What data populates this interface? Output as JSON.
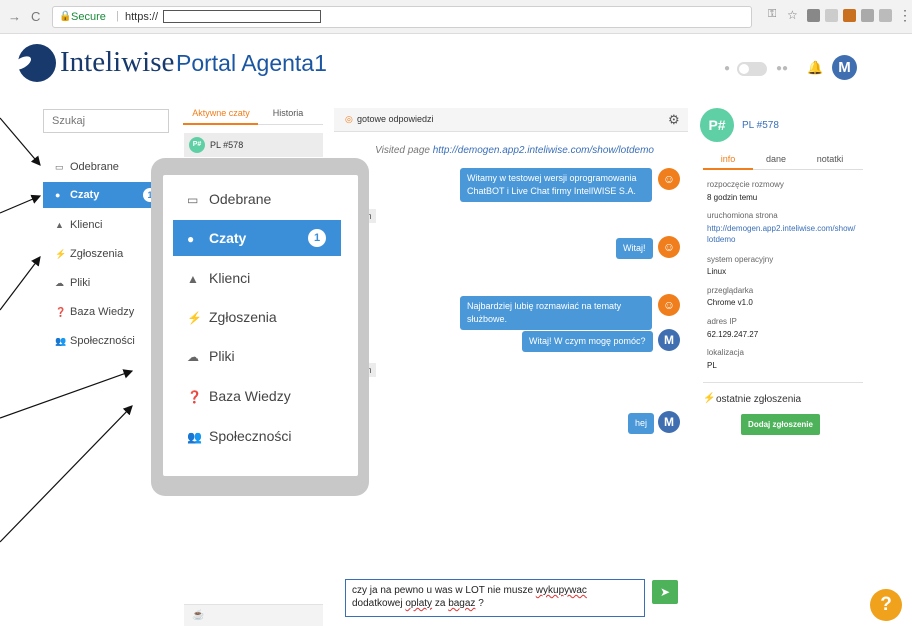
{
  "browser": {
    "back_icon": "arrow-left-icon",
    "reload_glyph": "C",
    "secure_label": "Secure",
    "url_prefix": "https://",
    "menu_glyph": "⋮"
  },
  "header": {
    "brand": "Inteliwise",
    "portal_title": "Portal Agenta1",
    "avatar_letter": "M"
  },
  "sidebar": {
    "search_placeholder": "Szukaj",
    "items": [
      {
        "label": "Odebrane",
        "icon": "inbox-icon"
      },
      {
        "label": "Czaty",
        "icon": "chat-bubble-icon",
        "badge": "1",
        "active": true
      },
      {
        "label": "Klienci",
        "icon": "user-icon"
      },
      {
        "label": "Zgłoszenia",
        "icon": "lightning-icon"
      },
      {
        "label": "Pliki",
        "icon": "cloud-icon"
      },
      {
        "label": "Baza Wiedzy",
        "icon": "help-circle-icon"
      },
      {
        "label": "Społeczności",
        "icon": "users-icon"
      }
    ]
  },
  "chatlist": {
    "tabs": [
      "Aktywne czaty",
      "Historia"
    ],
    "item_avatar": "P#",
    "item_label": "PL #578"
  },
  "chat": {
    "canned_label": "gotowe odpowiedzi",
    "visited_prefix": "Visited page ",
    "visited_url": "http://demogen.app2.inteliwise.com/show/lotdemo",
    "stub_1": "m",
    "stub_2": "m",
    "messages": [
      {
        "text": "Witamy w testowej wersji oprogramowania ChatBOT i Live Chat firmy IntelIWISE S.A.",
        "sender": "agent"
      },
      {
        "text": "Witaj!",
        "sender": "agent"
      },
      {
        "text": "Najbardziej lubię rozmawiać na tematy służbowe.",
        "sender": "agent"
      },
      {
        "text": "Witaj! W czym mogę pomóc?",
        "sender": "user"
      },
      {
        "text": "hej",
        "sender": "user"
      }
    ],
    "composer_before": "czy ja na pewno u was w LOT nie musze ",
    "composer_word1": "wykupywac",
    "composer_mid": " dodatkowej ",
    "composer_word2": "oplaty",
    "composer_mid2": " za ",
    "composer_word3": "bagaz",
    "composer_after": " ?"
  },
  "right_panel": {
    "visitor_avatar": "P#",
    "visitor_id": "PL #578",
    "tabs": [
      "info",
      "dane",
      "notatki"
    ],
    "fields": [
      {
        "label": "rozpoczęcie rozmowy",
        "value": "8 godzin temu"
      },
      {
        "label": "uruchomiona strona",
        "value": "http://demogen.app2.inteliwise.com/show/lotdemo"
      },
      {
        "label": "system operacyjny",
        "value": "Linux"
      },
      {
        "label": "przeglądarka",
        "value": "Chrome v1.0"
      },
      {
        "label": "adres IP",
        "value": "62.129.247.27"
      },
      {
        "label": "lokalizacja",
        "value": "PL"
      }
    ],
    "tickets_title": "ostatnie zgłoszenia",
    "add_ticket": "Dodaj zgłoszenie"
  },
  "help_label": "?",
  "colors": {
    "accent_blue": "#3b8fd9",
    "brand_navy": "#17396b",
    "orange": "#f07e1c",
    "green": "#4db25a",
    "teal_avatar": "#5fd0a6"
  }
}
